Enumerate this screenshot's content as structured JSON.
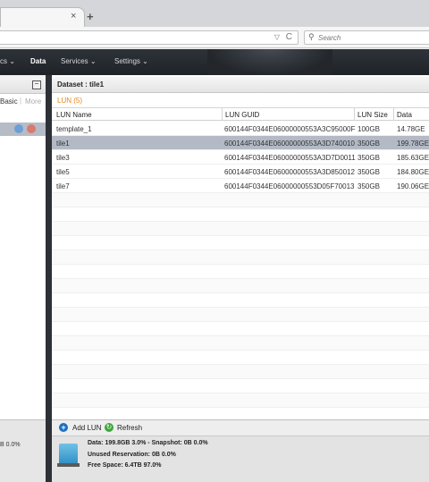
{
  "browser": {
    "tab_close": "×",
    "new_tab": "+",
    "search_placeholder": "Search",
    "url_dropdown": "▽",
    "reload": "C"
  },
  "nav": {
    "items": [
      {
        "label": "cs",
        "active": false
      },
      {
        "label": "Data",
        "active": true
      },
      {
        "label": "Services",
        "active": false
      },
      {
        "label": "Settings",
        "active": false
      }
    ]
  },
  "left_panel": {
    "collapse": "−",
    "basic": "Basic",
    "more": "More",
    "footer_text": "B 0.0%"
  },
  "dataset": {
    "breadcrumb": "Dataset : tile1",
    "lun_count": "LUN (5)"
  },
  "table": {
    "columns": [
      "LUN Name",
      "LUN GUID",
      "LUN Size",
      "Data"
    ],
    "rows": [
      {
        "name": "template_1",
        "guid": "600144F0344E06000000553A3C95000F",
        "size": "100GB",
        "data": "14.78GE",
        "selected": false
      },
      {
        "name": "tile1",
        "guid": "600144F0344E06000000553A3D740010",
        "size": "350GB",
        "data": "199.78GE",
        "selected": true
      },
      {
        "name": "tile3",
        "guid": "600144F0344E06000000553A3D7D0011",
        "size": "350GB",
        "data": "185.63GE",
        "selected": false
      },
      {
        "name": "tile5",
        "guid": "600144F0344E06000000553A3D850012",
        "size": "350GB",
        "data": "184.80GE",
        "selected": false
      },
      {
        "name": "tile7",
        "guid": "600144F0344E06000000553D05F70013",
        "size": "350GB",
        "data": "190.06GE",
        "selected": false
      }
    ]
  },
  "actions": {
    "add_lun": "Add LUN",
    "refresh": "Refresh"
  },
  "status": {
    "data": "Data: 199.8GB 3.0% - Snapshot: 0B 0.0%",
    "unused": "Unused Reservation: 0B 0.0%",
    "free": "Free Space: 6.4TB 97.0%"
  },
  "colors": {
    "header_bg": "#23272c",
    "selected_row": "#b3bac5",
    "lun_count": "#e8851a",
    "add_icon": "#1a6fc2",
    "refresh_icon": "#3da63a"
  }
}
